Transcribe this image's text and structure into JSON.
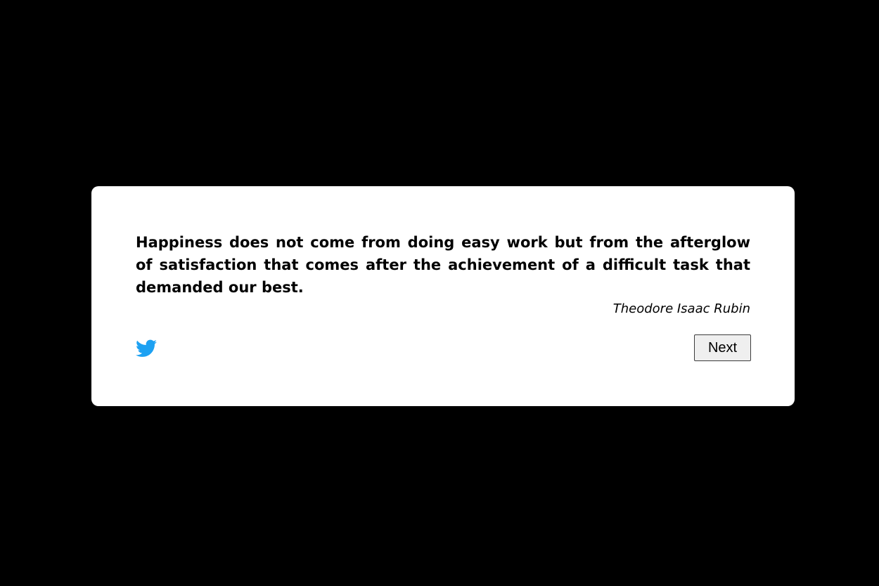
{
  "quote": {
    "text": "Happiness does not come from doing easy work but from the afterglow of satisfaction that comes after the achievement of a difficult task that demanded our best.",
    "author": "Theodore Isaac Rubin"
  },
  "actions": {
    "tweet_icon": "twitter-icon",
    "next_label": "Next"
  },
  "colors": {
    "background": "#000000",
    "card": "#ffffff",
    "twitter_blue": "#1da1f2"
  }
}
